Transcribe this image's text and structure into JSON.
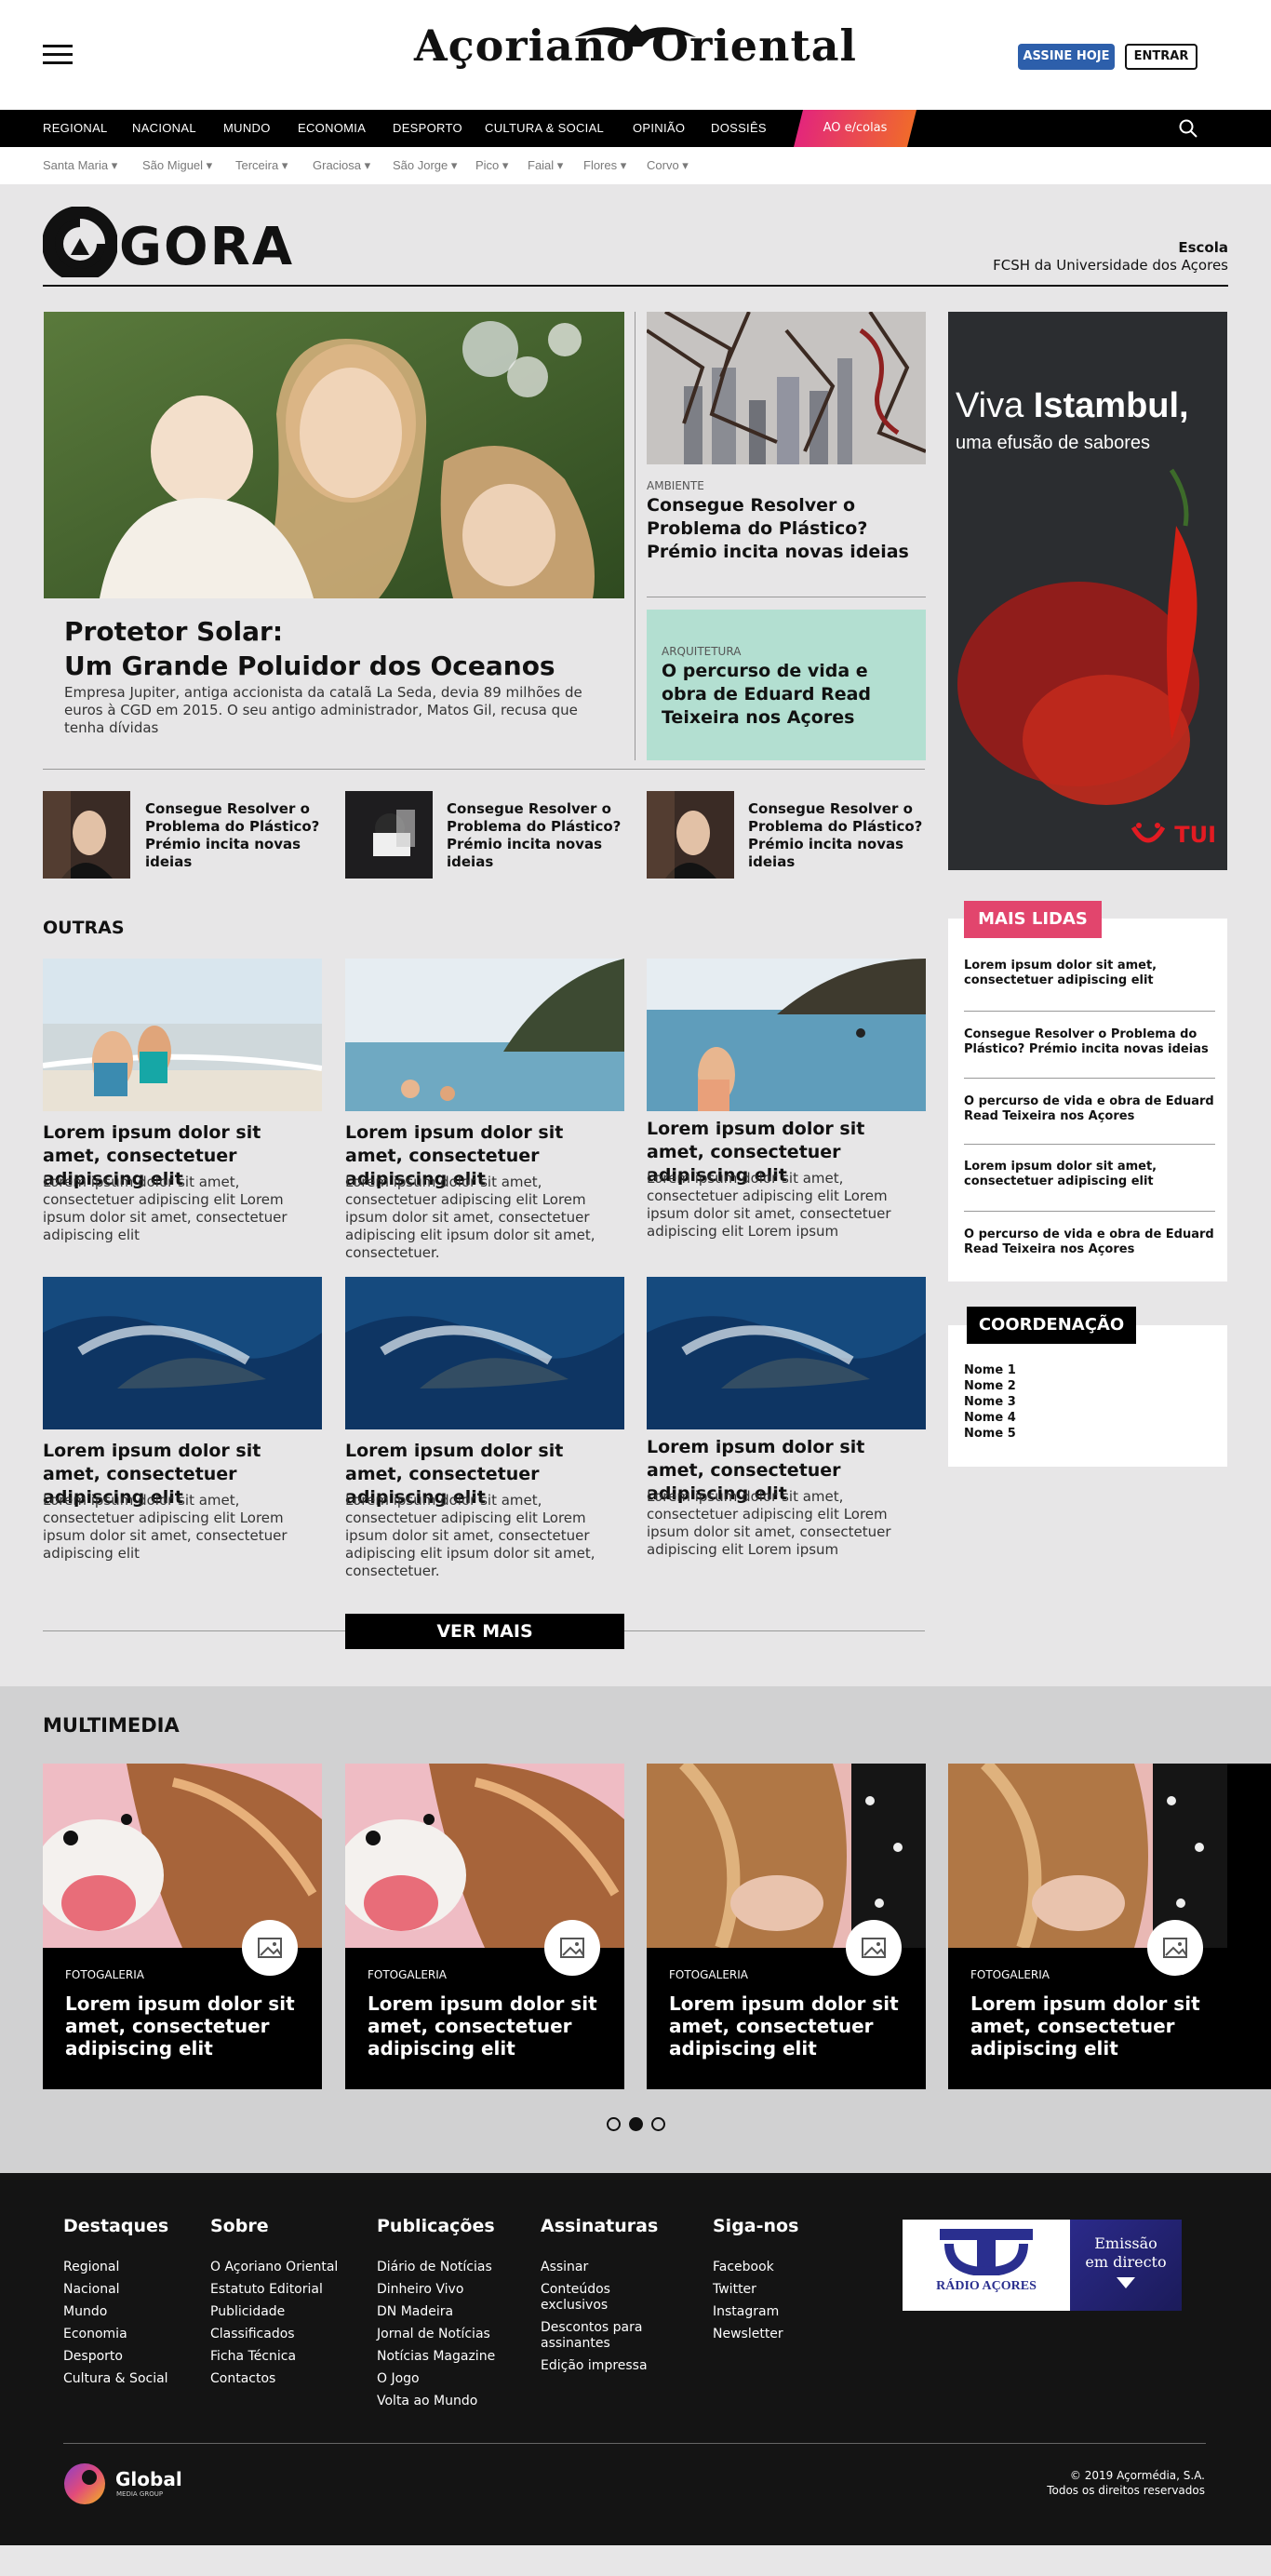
{
  "header": {
    "brand": "Açoriano Oriental",
    "subscribe_label": "ASSINE HOJE",
    "login_label": "ENTRAR"
  },
  "nav": {
    "items": [
      "REGIONAL",
      "NACIONAL",
      "MUNDO",
      "ECONOMIA",
      "DESPORTO",
      "CULTURA & SOCIAL",
      "OPINIÃO",
      "DOSSIÊS"
    ],
    "escolas_label": "AO e/colas",
    "subitems": [
      "Santa Maria",
      "São Miguel",
      "Terceira",
      "Graciosa",
      "São Jorge",
      "Pico",
      "Faial",
      "Flores",
      "Corvo"
    ]
  },
  "agora": {
    "logo_text": "GORA",
    "escola_label": "Escola",
    "escola_name": "FCSH da Universidade dos Açores"
  },
  "hero": {
    "title_line1": "Protetor Solar:",
    "title_line2": "Um Grande Poluidor dos Oceanos",
    "desc": "Empresa Jupiter, antiga accionista da catalã La Seda, devia 89 milhões de euros à CGD em 2015. O seu antigo administrador, Matos Gil, recusa que tenha dívidas"
  },
  "side_stories": [
    {
      "category": "AMBIENTE",
      "title": "Consegue Resolver o Problema do Plástico? Prémio incita novas ideias"
    },
    {
      "category": "ARQUITETURA",
      "title": "O percurso de vida e obra de Eduard Read Teixeira nos Açores"
    }
  ],
  "ad": {
    "line1": "Viva ",
    "line1b": "Istambul,",
    "line2": "uma efusão de sabores",
    "brand": "TUI"
  },
  "thumbs": [
    {
      "title": "Consegue Resolver o Problema do Plástico? Prémio incita novas ideias"
    },
    {
      "title": "Consegue Resolver o Problema do Plástico? Prémio incita novas ideias"
    },
    {
      "title": "Consegue Resolver o Problema do Plástico? Prémio incita novas ideias"
    }
  ],
  "outras": {
    "title": "OUTRAS",
    "articles": [
      {
        "title": "Lorem ipsum dolor sit amet, consectetuer adipiscing elit",
        "desc": "Lorem ipsum dolor sit amet, consectetuer adipiscing elit Lorem ipsum dolor sit amet, consectetuer adipiscing elit"
      },
      {
        "title": "Lorem ipsum dolor sit amet, consectetuer adipiscing elit",
        "desc": "Lorem ipsum dolor sit amet, consectetuer adipiscing elit Lorem ipsum dolor sit amet, consectetuer adipiscing elit ipsum dolor sit amet, consectetuer."
      },
      {
        "title": "Lorem ipsum dolor sit amet, consectetuer adipiscing elit",
        "desc": "Lorem ipsum dolor sit amet, consectetuer adipiscing elit Lorem ipsum dolor sit amet, consectetuer adipiscing elit Lorem ipsum"
      },
      {
        "title": "Lorem ipsum dolor sit amet, consectetuer adipiscing elit",
        "desc": "Lorem ipsum dolor sit amet, consectetuer adipiscing elit Lorem ipsum dolor sit amet, consectetuer adipiscing elit"
      },
      {
        "title": "Lorem ipsum dolor sit amet, consectetuer adipiscing elit",
        "desc": "Lorem ipsum dolor sit amet, consectetuer adipiscing elit Lorem ipsum dolor sit amet, consectetuer adipiscing elit ipsum dolor sit amet, consectetuer."
      },
      {
        "title": "Lorem ipsum dolor sit amet, consectetuer adipiscing elit",
        "desc": "Lorem ipsum dolor sit amet, consectetuer adipiscing elit Lorem ipsum dolor sit amet, consectetuer adipiscing elit Lorem ipsum"
      }
    ],
    "more_label": "VER MAIS"
  },
  "mais_lidas": {
    "title": "MAIS LIDAS",
    "items": [
      "Lorem ipsum dolor sit amet, consectetuer adipiscing elit",
      "Consegue Resolver o Problema do Plástico? Prémio incita novas ideias",
      "O percurso de vida e obra de Eduard Read Teixeira nos Açores",
      "Lorem ipsum dolor sit amet, consectetuer adipiscing elit",
      "O percurso de vida e obra de Eduard Read Teixeira nos Açores"
    ]
  },
  "coordenacao": {
    "title": "COORDENAÇÃO",
    "names": [
      "Nome 1",
      "Nome 2",
      "Nome 3",
      "Nome 4",
      "Nome 5"
    ]
  },
  "multimedia": {
    "title": "MULTIMEDIA",
    "cards": [
      {
        "category": "FOTOGALERIA",
        "title": "Lorem ipsum dolor sit amet, consectetuer adipiscing elit"
      },
      {
        "category": "FOTOGALERIA",
        "title": "Lorem ipsum dolor sit amet, consectetuer adipiscing elit"
      },
      {
        "category": "FOTOGALERIA",
        "title": "Lorem ipsum dolor sit amet, consectetuer adipiscing elit"
      },
      {
        "category": "FOTOGALERIA",
        "title": "Lorem ipsum dolor sit amet, consectetuer adipiscing elit"
      }
    ],
    "active_dot": 2,
    "dot_count": 3
  },
  "footer": {
    "columns": [
      {
        "title": "Destaques",
        "links": [
          "Regional",
          "Nacional",
          "Mundo",
          "Economia",
          "Desporto",
          "Cultura & Social"
        ]
      },
      {
        "title": "Sobre",
        "links": [
          "O Açoriano Oriental",
          "Estatuto Editorial",
          "Publicidade",
          "Classificados",
          "Ficha Técnica",
          "Contactos"
        ]
      },
      {
        "title": "Publicações",
        "links": [
          "Diário de Notícias",
          "Dinheiro Vivo",
          "DN Madeira",
          "Jornal de Notícias",
          "Notícias Magazine",
          "O Jogo",
          "Volta ao Mundo"
        ]
      },
      {
        "title": "Assinaturas",
        "links": [
          "Assinar",
          "Conteúdos exclusivos",
          "Descontos para assinantes",
          "Edição impressa"
        ]
      },
      {
        "title": "Siga-nos",
        "links": [
          "Facebook",
          "Twitter",
          "Instagram",
          "Newsletter"
        ]
      }
    ],
    "radio": {
      "name": "RÁDIO AÇORES",
      "live_line1": "Emissão",
      "live_line2": "em directo"
    },
    "group_logo": "Global",
    "group_sub": "MEDIA GROUP",
    "copyright_line1": "© 2019 Açormédia, S.A.",
    "copyright_line2": "Todos os direitos reservados"
  },
  "colors": {
    "accent_blue": "#2d5fab",
    "mais_lidas_pink": "#e2456d",
    "arquitetura_mint": "#b3dfd1",
    "nav_black": "#000000"
  }
}
